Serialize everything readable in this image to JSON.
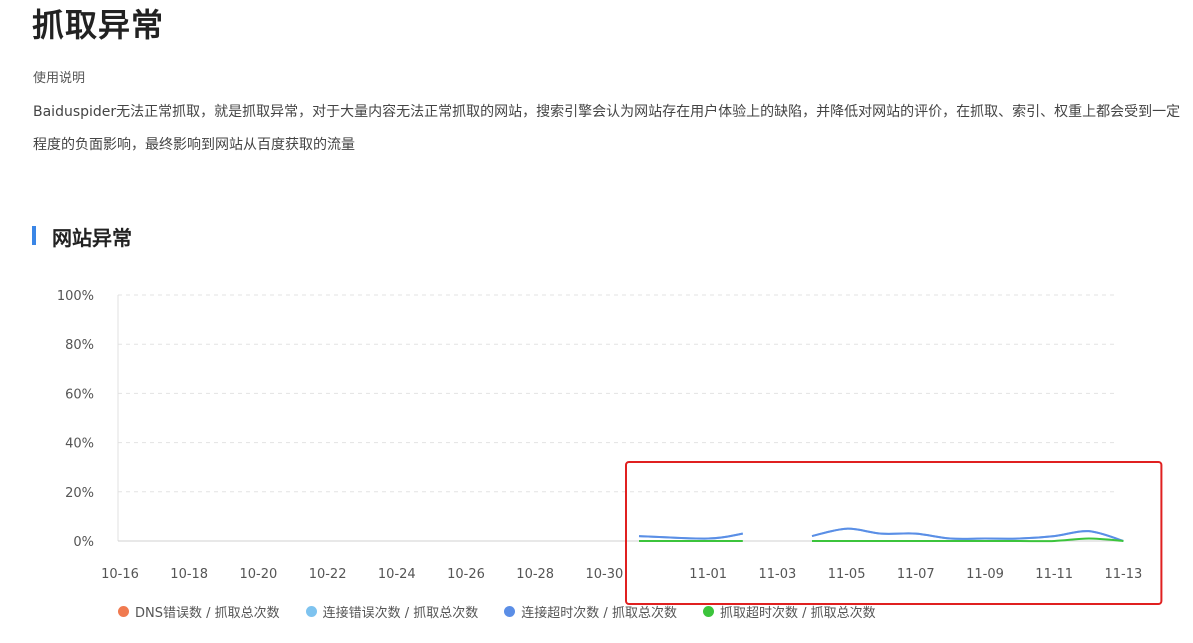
{
  "page": {
    "title": "抓取异常",
    "usage_label": "使用说明",
    "description": "Baiduspider无法正常抓取，就是抓取异常，对于大量内容无法正常抓取的网站，搜索引擎会认为网站存在用户体验上的缺陷，并降低对网站的评价，在抓取、索引、权重上都会受到一定程度的负面影响，最终影响到网站从百度获取的流量"
  },
  "section": {
    "title": "网站异常"
  },
  "colors": {
    "accent": "#3a86e6",
    "highlight_box": "#e02020",
    "grid": "#e3e3e3"
  },
  "chart_data": {
    "type": "line",
    "title": "",
    "xlabel": "",
    "ylabel": "",
    "ylim": [
      0,
      100
    ],
    "yticks": [
      "0%",
      "20%",
      "40%",
      "60%",
      "80%",
      "100%"
    ],
    "xticks": [
      "10-16",
      "10-18",
      "10-20",
      "10-22",
      "10-24",
      "10-26",
      "10-28",
      "10-30",
      "11-01",
      "11-03",
      "11-05",
      "11-07",
      "11-09",
      "11-11",
      "11-13"
    ],
    "grid": true,
    "legend_position": "bottom",
    "series": [
      {
        "name": "DNS错误数 / 抓取总次数",
        "color": "#f07a50",
        "points": []
      },
      {
        "name": "连接错误次数 / 抓取总次数",
        "color": "#7ec3ef",
        "points": [
          [
            "10-31",
            2
          ],
          [
            "11-01",
            1
          ],
          [
            "11-02",
            3
          ],
          [
            null,
            null
          ],
          [
            "11-04",
            2
          ],
          [
            "11-05",
            5
          ],
          [
            "11-06",
            3
          ],
          [
            "11-07",
            3
          ],
          [
            "11-08",
            1
          ],
          [
            "11-09",
            1
          ],
          [
            "11-10",
            1
          ],
          [
            "11-11",
            2
          ],
          [
            "11-12",
            4
          ],
          [
            "11-13",
            0
          ]
        ]
      },
      {
        "name": "连接超时次数 / 抓取总次数",
        "color": "#5b8ee6",
        "points": [
          [
            "10-31",
            2
          ],
          [
            "11-01",
            1
          ],
          [
            "11-02",
            3
          ],
          [
            null,
            null
          ],
          [
            "11-04",
            2
          ],
          [
            "11-05",
            5
          ],
          [
            "11-06",
            3
          ],
          [
            "11-07",
            3
          ],
          [
            "11-08",
            1
          ],
          [
            "11-09",
            1
          ],
          [
            "11-10",
            1
          ],
          [
            "11-11",
            2
          ],
          [
            "11-12",
            4
          ],
          [
            "11-13",
            0
          ]
        ]
      },
      {
        "name": "抓取超时次数 / 抓取总次数",
        "color": "#3cc43c",
        "points": [
          [
            "10-31",
            0
          ],
          [
            "11-01",
            0
          ],
          [
            "11-02",
            0
          ],
          [
            null,
            null
          ],
          [
            "11-04",
            0
          ],
          [
            "11-05",
            0
          ],
          [
            "11-06",
            0
          ],
          [
            "11-07",
            0
          ],
          [
            "11-08",
            0
          ],
          [
            "11-09",
            0
          ],
          [
            "11-10",
            0
          ],
          [
            "11-11",
            0
          ],
          [
            "11-12",
            1
          ],
          [
            "11-13",
            0
          ]
        ]
      }
    ],
    "annotation": {
      "type": "highlight-box",
      "from": "10-31",
      "to": "11-13"
    }
  }
}
